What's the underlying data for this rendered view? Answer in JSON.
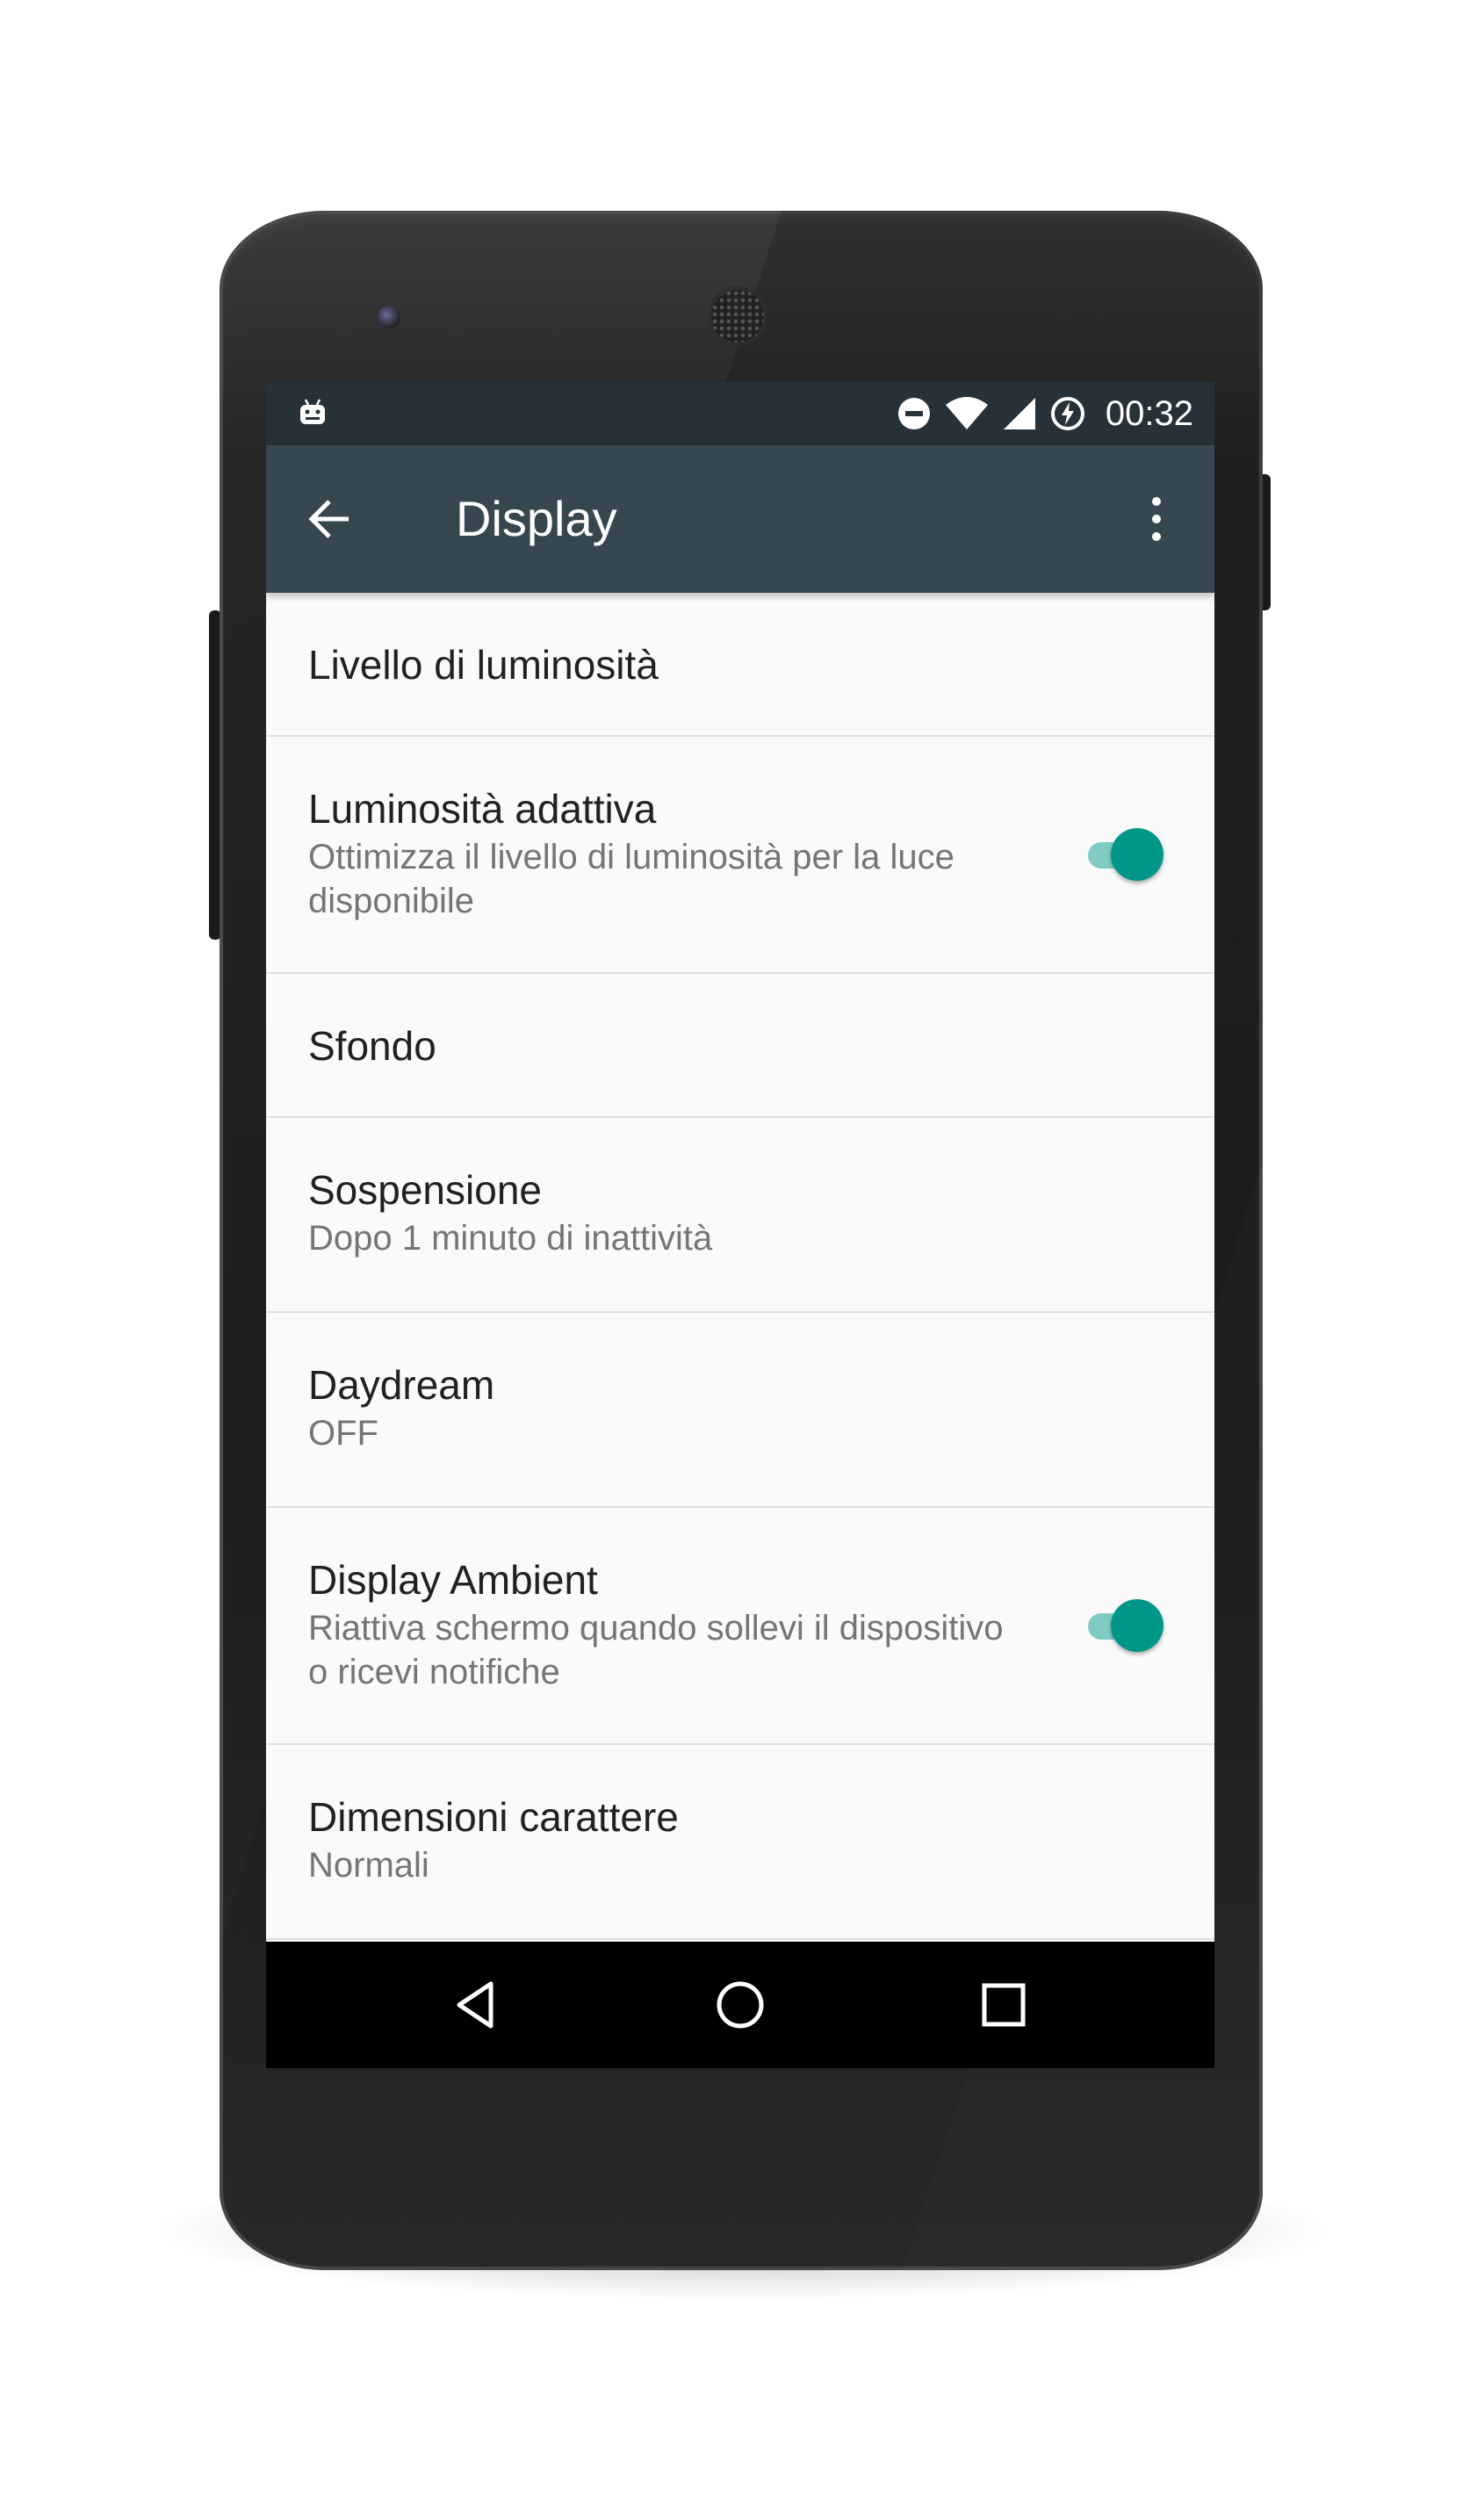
{
  "status_bar": {
    "time": "00:32",
    "icons": [
      "android-debug-icon",
      "do-not-disturb-icon",
      "wifi-icon",
      "cell-signal-icon",
      "battery-saver-icon"
    ]
  },
  "app_bar": {
    "title": "Display",
    "back_icon": "arrow-back-icon",
    "overflow_icon": "more-vert-icon"
  },
  "settings": [
    {
      "title": "Livello di luminosità"
    },
    {
      "title": "Luminosità adattiva",
      "summary": "Ottimizza il livello di luminosità per la luce disponibile",
      "toggle": true
    },
    {
      "title": "Sfondo"
    },
    {
      "title": "Sospensione",
      "summary": "Dopo 1 minuto di inattività"
    },
    {
      "title": "Daydream",
      "summary": "OFF"
    },
    {
      "title": "Display Ambient",
      "summary": "Riattiva schermo quando sollevi il dispositivo o ricevi notifiche",
      "toggle": true
    },
    {
      "title": "Dimensioni carattere",
      "summary": "Normali"
    }
  ],
  "nav_bar": {
    "icons": [
      "nav-back-icon",
      "nav-home-icon",
      "nav-recents-icon"
    ]
  },
  "colors": {
    "status_bar": "#263238",
    "app_bar": "#37474f",
    "accent": "#009688",
    "accent_track": "#80cbc4",
    "background": "#fafafa"
  }
}
